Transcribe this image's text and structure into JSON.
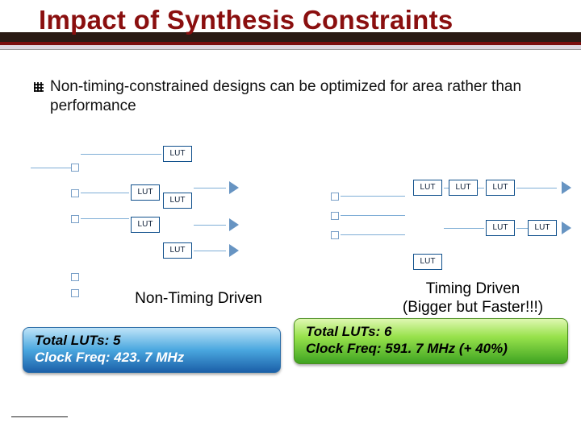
{
  "title": "Impact of Synthesis Constraints",
  "bullet": "Non-timing-constrained designs can be optimized for area rather than performance",
  "lut_label": "LUT",
  "left_diag": {
    "caption": "Non-Timing Driven",
    "stat1": "Total  LUTs: 5",
    "stat2": "Clock  Freq: 423. 7 MHz"
  },
  "right_diag": {
    "caption_l1": "Timing Driven",
    "caption_l2": "(Bigger but Faster!!!)",
    "stat1": "Total  LUTs: 6",
    "stat2": "Clock  Freq: 591. 7 MHz (+ 40%)"
  }
}
